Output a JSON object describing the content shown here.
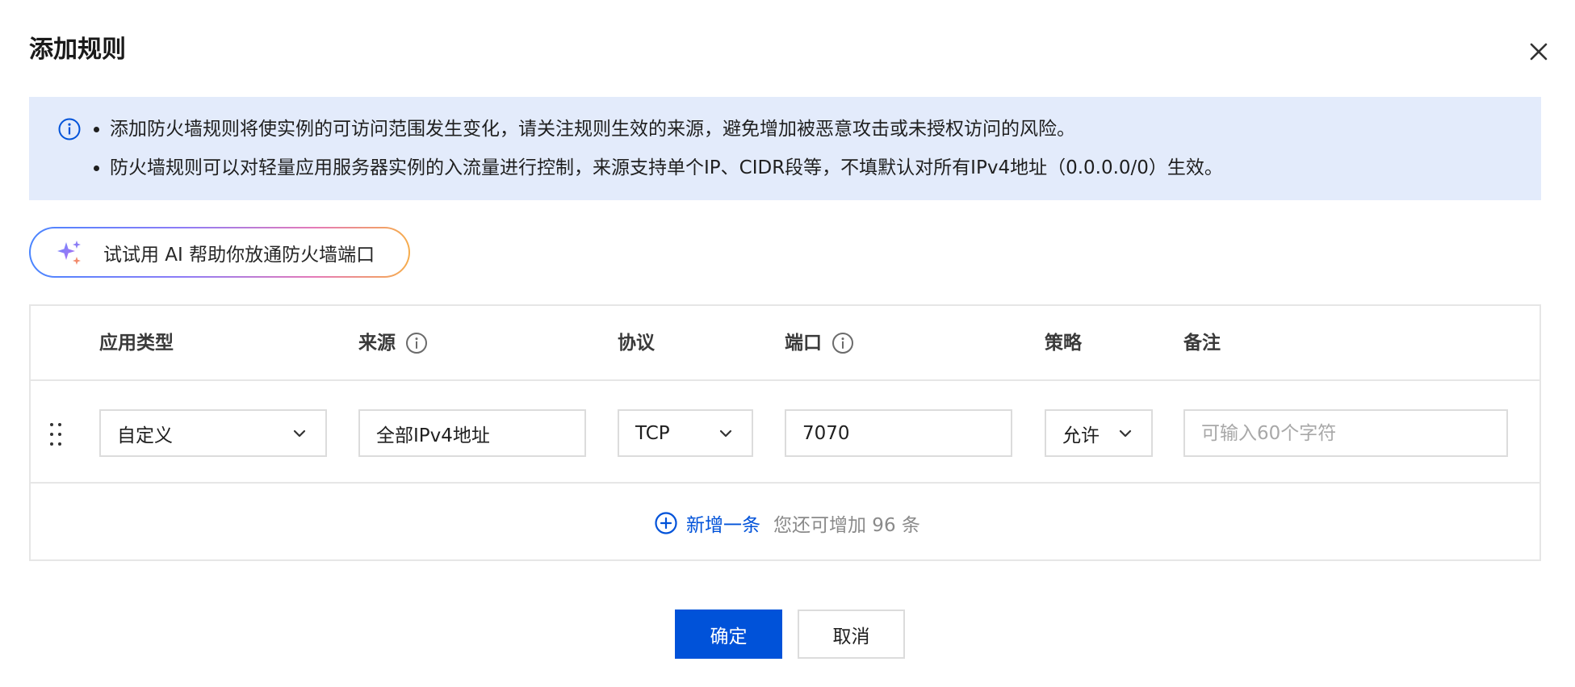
{
  "dialog": {
    "title": "添加规则",
    "close_icon": "close-icon"
  },
  "notice": {
    "icon": "info-icon",
    "items": [
      "添加防火墙规则将使实例的可访问范围发生变化，请关注规则生效的来源，避免增加被恶意攻击或未授权访问的风险。",
      "防火墙规则可以对轻量应用服务器实例的入流量进行控制，来源支持单个IP、CIDR段等，不填默认对所有IPv4地址（0.0.0.0/0）生效。"
    ]
  },
  "ai_assist": {
    "icon": "sparkle-icon",
    "label": "试试用 AI 帮助你放通防火墙端口",
    "gradient_colors": [
      "#4a85ff",
      "#8d7cf7",
      "#e57ab8",
      "#f6ad4c"
    ]
  },
  "table": {
    "columns": {
      "app_type": "应用类型",
      "source": "来源",
      "protocol": "协议",
      "port": "端口",
      "policy": "策略",
      "remark": "备注"
    },
    "tip_icon": "info-circle-icon",
    "rows": [
      {
        "app_type": "自定义",
        "source": "全部IPv4地址",
        "protocol": "TCP",
        "port": "7070",
        "policy": "允许",
        "remark_placeholder": "可输入60个字符"
      }
    ]
  },
  "add_row": {
    "icon": "plus-circle-icon",
    "label": "新增一条",
    "remaining_text": "您还可增加 96 条"
  },
  "footer": {
    "confirm_label": "确定",
    "cancel_label": "取消"
  },
  "colors": {
    "primary": "#0052d9",
    "notice_bg": "#e3ebfb",
    "border": "#e6e6e6"
  }
}
